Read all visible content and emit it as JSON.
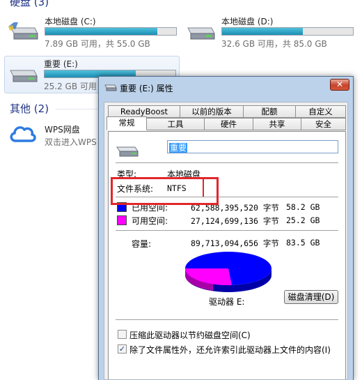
{
  "explorer": {
    "hard_disks_group": {
      "title": "硬盘",
      "count": "(3)"
    },
    "drives": [
      {
        "name": "本地磁盘 (C:)",
        "free": "7.89 GB 可用，共 55.0 GB",
        "used_fraction": 0.857
      },
      {
        "name": "本地磁盘 (D:)",
        "free": "32.6 GB 可用，共 85.0 GB",
        "used_fraction": 0.616
      },
      {
        "name": "重要 (E:)",
        "free": "25.2 GB 可用",
        "used_fraction": 0.697
      }
    ],
    "other_group": {
      "title": "其他",
      "count": "(2)"
    },
    "wps": {
      "name": "WPS网盘",
      "sub": "双击进入WPS"
    }
  },
  "dialog": {
    "title": "重要 (E:) 属性",
    "close_label": "✕",
    "tabs_top": [
      "ReadyBoost",
      "以前的版本",
      "配额",
      "自定义"
    ],
    "tabs_bottom": [
      "常规",
      "工具",
      "硬件",
      "共享",
      "安全"
    ],
    "volume_name": "重要",
    "type_label": "类型:",
    "type_value": "本地磁盘",
    "fs_label": "文件系统:",
    "fs_value": "NTFS",
    "used_label": "已用空间:",
    "used_bytes": "62,588,395,520 字节",
    "used_size": "58.2 GB",
    "free_label": "可用空间:",
    "free_bytes": "27,124,699,136 字节",
    "free_size": "25.2 GB",
    "capacity_label": "容量:",
    "capacity_bytes": "89,713,094,656 字节",
    "capacity_size": "83.5 GB",
    "used_color": "#0000ff",
    "free_color": "#ff00ff",
    "used_fraction": 0.698,
    "drive_label": "驱动器 E:",
    "cleanup_button": "磁盘清理(D)",
    "compress_label": "压缩此驱动器以节约磁盘空间(C)",
    "compress_checked": false,
    "index_label": "除了文件属性外，还允许索引此驱动器上文件的内容(I)",
    "index_checked": true
  },
  "annotation": {
    "highlight_color": "#e2262b"
  }
}
